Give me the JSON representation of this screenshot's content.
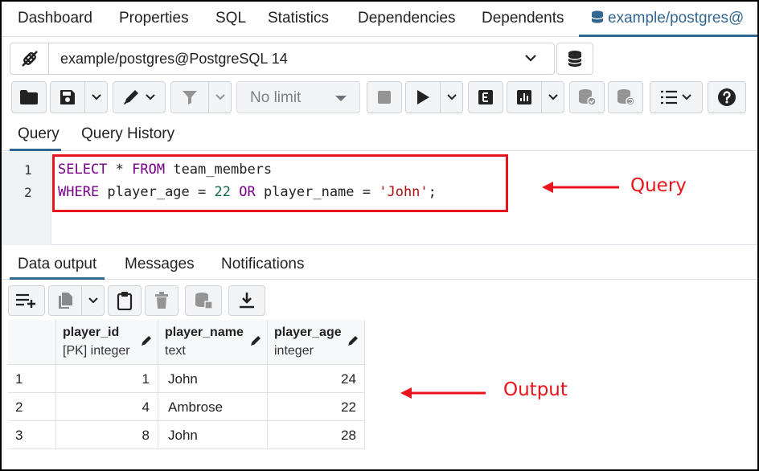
{
  "top_tabs": [
    "Dashboard",
    "Properties",
    "SQL",
    "Statistics",
    "Dependencies",
    "Dependents",
    "example/postgres@"
  ],
  "connection": {
    "label": "example/postgres@PostgreSQL 14"
  },
  "toolbar": {
    "limit_select": "No limit"
  },
  "editor_tabs": [
    "Query",
    "Query History"
  ],
  "editor": {
    "line_numbers": [
      "1",
      "2"
    ],
    "line1": {
      "kw1": "SELECT",
      "t1": " * ",
      "kw2": "FROM",
      "t2": " team_members"
    },
    "line2": {
      "kw1": "WHERE",
      "t1": " player_age = ",
      "num": "22",
      "t2": " ",
      "kw2": "OR",
      "t3": " player_name = ",
      "str": "'John'",
      "t4": ";"
    }
  },
  "annotations": {
    "query_label": "Query",
    "output_label": "Output",
    "color": "#e8141c"
  },
  "output_tabs": [
    "Data output",
    "Messages",
    "Notifications"
  ],
  "table": {
    "columns": [
      {
        "name": "player_id",
        "type": "[PK] integer"
      },
      {
        "name": "player_name",
        "type": "text"
      },
      {
        "name": "player_age",
        "type": "integer"
      }
    ],
    "rows": [
      {
        "n": "1",
        "player_id": "1",
        "player_name": "John",
        "player_age": "24"
      },
      {
        "n": "2",
        "player_id": "4",
        "player_name": "Ambrose",
        "player_age": "22"
      },
      {
        "n": "3",
        "player_id": "8",
        "player_name": "John",
        "player_age": "28"
      }
    ]
  },
  "colors": {
    "accent": "#326690",
    "annotation": "#e8141c",
    "keyword": "#770088",
    "number": "#116644",
    "string": "#aa1111"
  }
}
